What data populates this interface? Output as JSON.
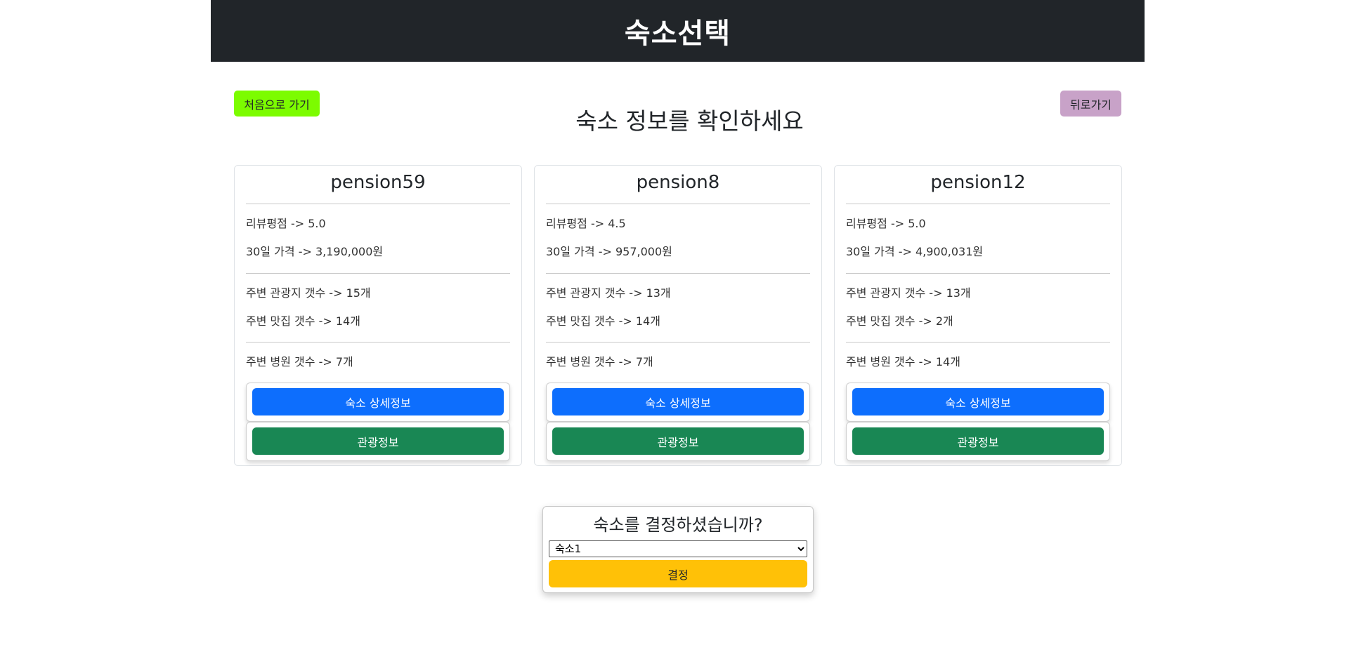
{
  "header": {
    "title": "숙소선택"
  },
  "nav": {
    "home_label": "처음으로 가기",
    "back_label": "뒤로가기"
  },
  "page": {
    "heading": "숙소 정보를 확인하세요"
  },
  "cards": [
    {
      "name": "pension59",
      "rating": "리뷰평점 -> 5.0",
      "price": "30일 가격 -> 3,190,000원",
      "attractions": "주변 관광지 갯수 -> 15개",
      "restaurants": "주변 맛집 갯수 -> 14개",
      "hospitals": "주변 병원 갯수 -> 7개",
      "detail_label": "숙소 상세정보",
      "tour_label": "관광정보"
    },
    {
      "name": "pension8",
      "rating": "리뷰평점 -> 4.5",
      "price": "30일 가격 -> 957,000원",
      "attractions": "주변 관광지 갯수 -> 13개",
      "restaurants": "주변 맛집 갯수 -> 14개",
      "hospitals": "주변 병원 갯수 -> 7개",
      "detail_label": "숙소 상세정보",
      "tour_label": "관광정보"
    },
    {
      "name": "pension12",
      "rating": "리뷰평점 -> 5.0",
      "price": "30일 가격 -> 4,900,031원",
      "attractions": "주변 관광지 갯수 -> 13개",
      "restaurants": "주변 맛집 갯수 -> 2개",
      "hospitals": "주변 병원 갯수 -> 14개",
      "detail_label": "숙소 상세정보",
      "tour_label": "관광정보"
    }
  ],
  "decision": {
    "title": "숙소를 결정하셨습니까?",
    "selected_option": "숙소1",
    "button_label": "결정"
  },
  "colors": {
    "header_bg": "#212529",
    "home_button": "#7cfc00",
    "back_button": "#c8a2c8",
    "detail_button": "#0d6efd",
    "tour_button": "#198754",
    "decide_button": "#ffc107"
  }
}
